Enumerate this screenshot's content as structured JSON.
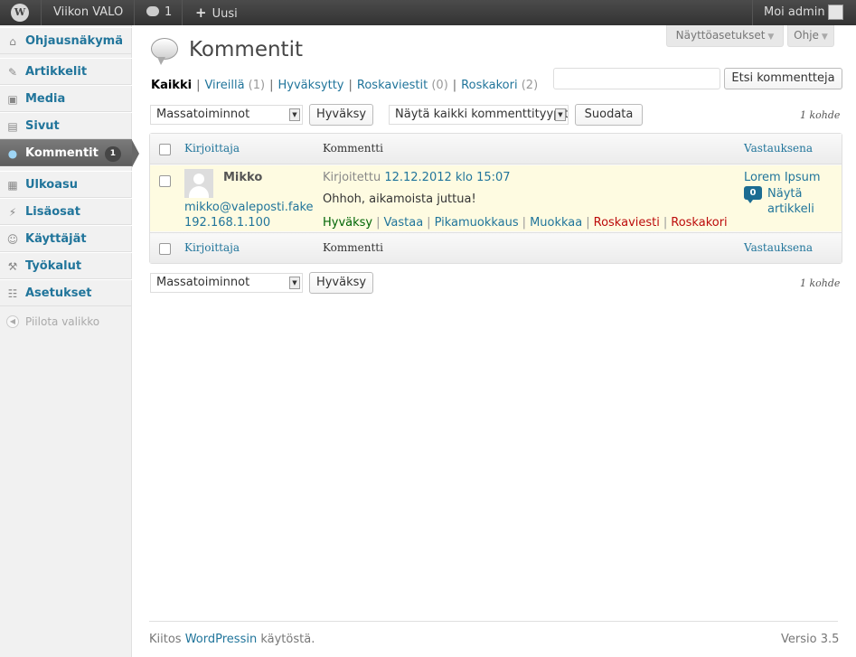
{
  "adminbar": {
    "wp_logo": "wordpress-logo",
    "site_name": "Viikon VALO",
    "comments_count": "1",
    "new_label": "Uusi",
    "account_label": "Moi admin"
  },
  "menu": {
    "items": [
      {
        "label": "Ohjausnäkymä",
        "icon": "dashboard-icon"
      },
      {
        "label": "Artikkelit",
        "icon": "pin-icon"
      },
      {
        "label": "Media",
        "icon": "media-icon"
      },
      {
        "label": "Sivut",
        "icon": "pages-icon"
      },
      {
        "label": "Kommentit",
        "icon": "comments-icon",
        "count": "1"
      },
      {
        "label": "Ulkoasu",
        "icon": "appearance-icon"
      },
      {
        "label": "Lisäosat",
        "icon": "plugins-icon"
      },
      {
        "label": "Käyttäjät",
        "icon": "users-icon"
      },
      {
        "label": "Työkalut",
        "icon": "tools-icon"
      },
      {
        "label": "Asetukset",
        "icon": "settings-icon"
      }
    ],
    "collapse_label": "Piilota valikko"
  },
  "screen_options": "Näyttöasetukset",
  "help": "Ohje",
  "page_title": "Kommentit",
  "filters": {
    "all": "Kaikki",
    "pending": "Vireillä",
    "pending_count": "(1)",
    "approved": "Hyväksytty",
    "spam": "Roskaviestit",
    "spam_count": "(0)",
    "trash": "Roskakori",
    "trash_count": "(2)"
  },
  "search": {
    "value": "",
    "button": "Etsi kommentteja"
  },
  "bulk": {
    "select_value": "Massatoiminnot",
    "apply": "Hyväksy",
    "type_filter": "Näytä kaikki kommenttityypit",
    "filter_button": "Suodata",
    "items_count": "1 kohde"
  },
  "table": {
    "col_author": "Kirjoittaja",
    "col_comment": "Kommentti",
    "col_response": "Vastauksena",
    "rows": [
      {
        "author": "Mikko",
        "email": "mikko@valeposti.fake",
        "ip": "192.168.1.100",
        "submitted_prefix": "Kirjoitettu",
        "date": "12.12.2012 klo 15:07",
        "text": "Ohhoh, aikamoista juttua!",
        "actions": {
          "approve": "Hyväksy",
          "reply": "Vastaa",
          "quickedit": "Pikamuokkaus",
          "edit": "Muokkaa",
          "spam": "Roskaviesti",
          "trash": "Roskakori"
        },
        "response_title": "Lorem Ipsum",
        "response_count": "0",
        "response_view": "Näytä artikkeli"
      }
    ]
  },
  "footer": {
    "thanks_prefix": "Kiitos",
    "thanks_link": "WordPressin",
    "thanks_suffix": "käytöstä.",
    "version": "Versio 3.5"
  }
}
